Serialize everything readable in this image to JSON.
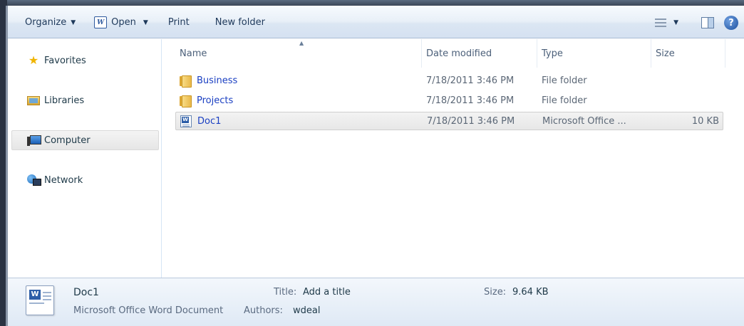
{
  "toolbar": {
    "organize_label": "Organize",
    "open_label": "Open",
    "print_label": "Print",
    "new_folder_label": "New folder",
    "help_glyph": "?"
  },
  "nav": {
    "items": [
      {
        "label": "Favorites",
        "icon": "star-icon"
      },
      {
        "label": "Libraries",
        "icon": "libraries-icon"
      },
      {
        "label": "Computer",
        "icon": "computer-icon",
        "selected": true
      },
      {
        "label": "Network",
        "icon": "network-icon"
      }
    ]
  },
  "columns": {
    "name": "Name",
    "date": "Date modified",
    "type": "Type",
    "size": "Size"
  },
  "files": [
    {
      "name": "Business",
      "date": "7/18/2011 3:46 PM",
      "type": "File folder",
      "size": "",
      "icon": "folder-icon"
    },
    {
      "name": "Projects",
      "date": "7/18/2011 3:46 PM",
      "type": "File folder",
      "size": "",
      "icon": "folder-icon"
    },
    {
      "name": "Doc1",
      "date": "7/18/2011 3:46 PM",
      "type": "Microsoft Office ...",
      "size": "10 KB",
      "icon": "word-document-icon",
      "selected": true
    }
  ],
  "details": {
    "file_name": "Doc1",
    "file_type": "Microsoft Office Word Document",
    "title_label": "Title:",
    "title_value": "Add a title",
    "authors_label": "Authors:",
    "authors_value": "wdeal",
    "size_label": "Size:",
    "size_value": "9.64 KB"
  },
  "colors": {
    "link_blue": "#1a3fc2",
    "toolbar_bg": "#dbe6f3",
    "details_bg": "#e6eef8"
  }
}
